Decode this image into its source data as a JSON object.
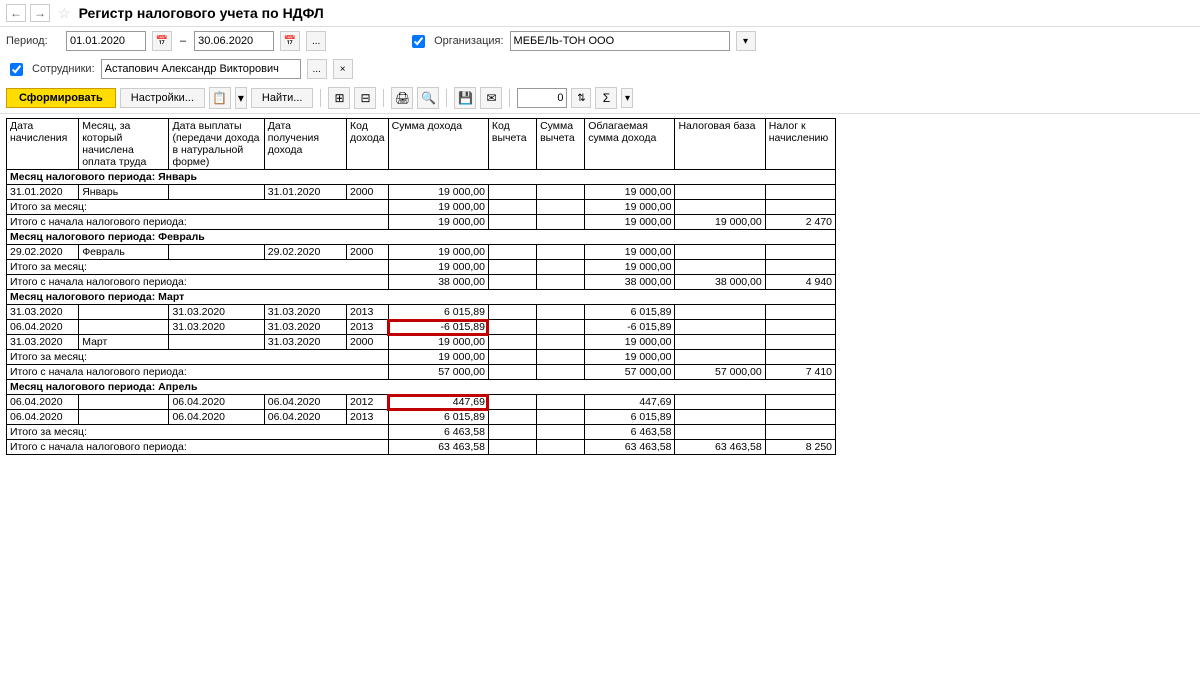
{
  "title": "Регистр налогового учета по НДФЛ",
  "period_label": "Период:",
  "date_from": "01.01.2020",
  "date_to": "30.06.2020",
  "org_label": "Организация:",
  "org_value": "МЕБЕЛЬ-ТОН ООО",
  "emp_label": "Сотрудники:",
  "emp_value": "Астапович Александр Викторович",
  "toolbar": {
    "form": "Сформировать",
    "settings": "Настройки...",
    "find": "Найти...",
    "count": "0"
  },
  "headers": {
    "c1": "Дата начисления",
    "c2": "Месяц, за который начислена оплата труда",
    "c3": "Дата выплаты (передачи дохода в натуральной форме)",
    "c4": "Дата получения дохода",
    "c5": "Код дохода",
    "c6": "Сумма дохода",
    "c7": "Код вычета",
    "c8": "Сумма вычета",
    "c9": "Облагаемая сумма дохода",
    "c10": "Налоговая база",
    "c11": "Налог к начислению"
  },
  "labels": {
    "month_total": "Итого за месяц:",
    "period_total": "Итого с начала налогового периода:",
    "month_prefix": "Месяц налогового периода:"
  },
  "months": [
    {
      "name": "Январь",
      "rows": [
        {
          "c1": "31.01.2020",
          "c2": "Январь",
          "c3": "",
          "c4": "31.01.2020",
          "c5": "2000",
          "c6": "19 000,00",
          "c9": "19 000,00"
        }
      ],
      "month_total": {
        "c6": "19 000,00",
        "c9": "19 000,00"
      },
      "period_total": {
        "c6": "19 000,00",
        "c9": "19 000,00",
        "c10": "19 000,00",
        "c11": "2 470"
      }
    },
    {
      "name": "Февраль",
      "rows": [
        {
          "c1": "29.02.2020",
          "c2": "Февраль",
          "c3": "",
          "c4": "29.02.2020",
          "c5": "2000",
          "c6": "19 000,00",
          "c9": "19 000,00"
        }
      ],
      "month_total": {
        "c6": "19 000,00",
        "c9": "19 000,00"
      },
      "period_total": {
        "c6": "38 000,00",
        "c9": "38 000,00",
        "c10": "38 000,00",
        "c11": "4 940"
      }
    },
    {
      "name": "Март",
      "rows": [
        {
          "c1": "31.03.2020",
          "c2": "",
          "c3": "31.03.2020",
          "c4": "31.03.2020",
          "c5": "2013",
          "c6": "6 015,89",
          "c9": "6 015,89"
        },
        {
          "c1": "06.04.2020",
          "c2": "",
          "c3": "31.03.2020",
          "c4": "31.03.2020",
          "c5": "2013",
          "c6": "-6 015,89",
          "c9": "-6 015,89",
          "hl": true
        },
        {
          "c1": "31.03.2020",
          "c2": "Март",
          "c3": "",
          "c4": "31.03.2020",
          "c5": "2000",
          "c6": "19 000,00",
          "c9": "19 000,00"
        }
      ],
      "month_total": {
        "c6": "19 000,00",
        "c9": "19 000,00"
      },
      "period_total": {
        "c6": "57 000,00",
        "c9": "57 000,00",
        "c10": "57 000,00",
        "c11": "7 410"
      }
    },
    {
      "name": "Апрель",
      "rows": [
        {
          "c1": "06.04.2020",
          "c2": "",
          "c3": "06.04.2020",
          "c4": "06.04.2020",
          "c5": "2012",
          "c6": "447,69",
          "c9": "447,69",
          "hl": true
        },
        {
          "c1": "06.04.2020",
          "c2": "",
          "c3": "06.04.2020",
          "c4": "06.04.2020",
          "c5": "2013",
          "c6": "6 015,89",
          "c9": "6 015,89"
        }
      ],
      "month_total": {
        "c6": "6 463,58",
        "c9": "6 463,58"
      },
      "period_total": {
        "c6": "63 463,58",
        "c9": "63 463,58",
        "c10": "63 463,58",
        "c11": "8 250"
      }
    }
  ]
}
